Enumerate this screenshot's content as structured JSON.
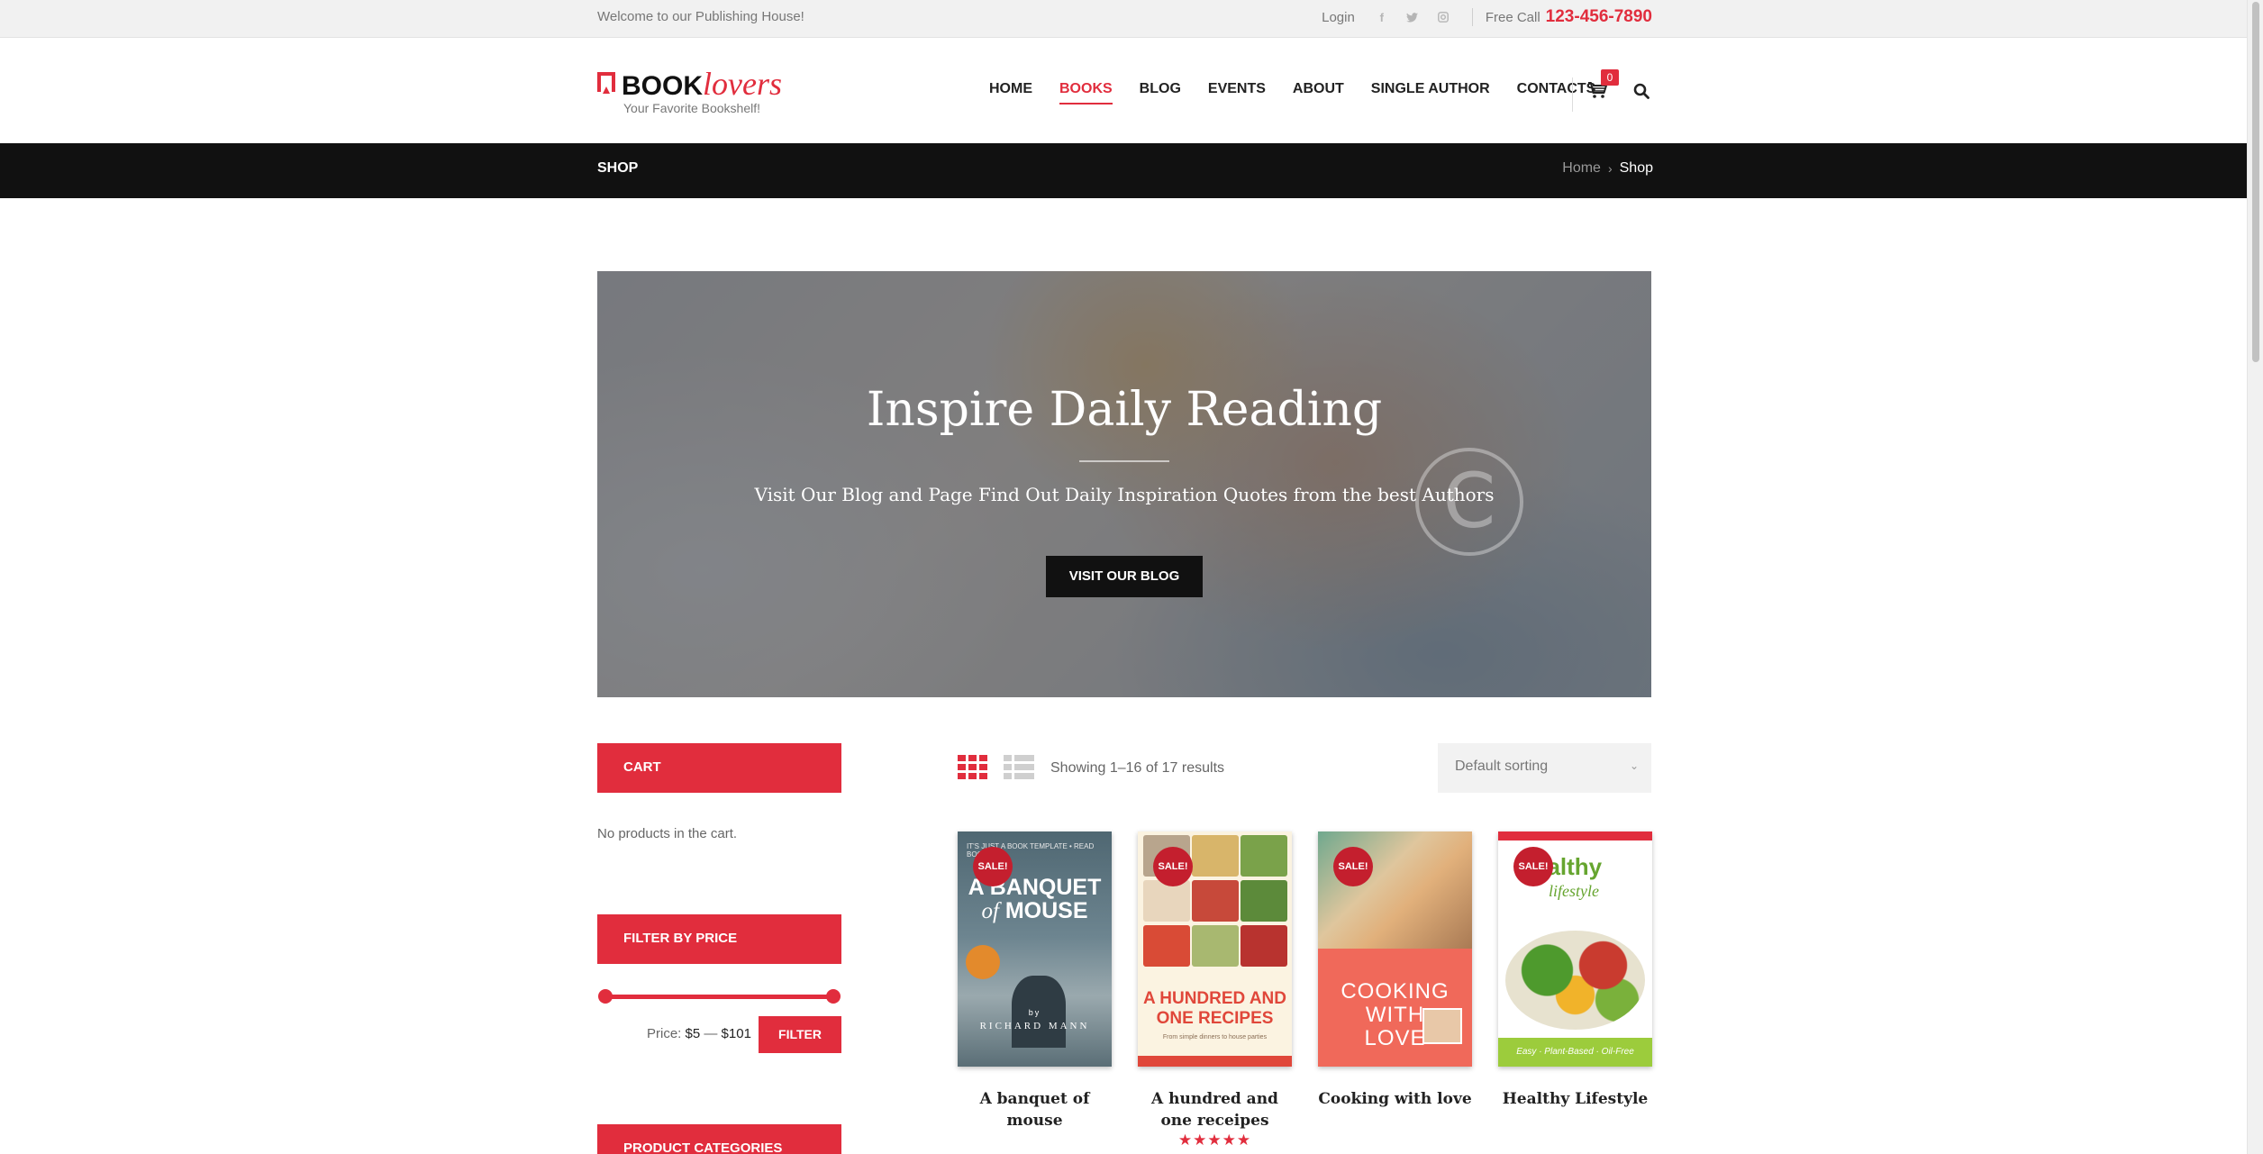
{
  "topbar": {
    "welcome": "Welcome to our Publishing House!",
    "login": "Login",
    "social_icons": [
      "facebook-icon",
      "twitter-icon",
      "instagram-icon"
    ],
    "free_call_label": "Free Call",
    "phone": "123-456-7890"
  },
  "logo": {
    "book": "BOOK",
    "lovers": "lovers",
    "tagline": "Your Favorite Bookshelf!"
  },
  "nav": {
    "items": [
      "HOME",
      "BOOKS",
      "BLOG",
      "EVENTS",
      "ABOUT",
      "SINGLE AUTHOR",
      "CONTACTS"
    ],
    "active": "BOOKS",
    "cart_count": "0"
  },
  "page": {
    "title": "SHOP",
    "breadcrumb": [
      "Home",
      "Shop"
    ]
  },
  "hero": {
    "heading": "Inspire Daily Reading",
    "subheading": "Visit Our Blog and Page Find Out Daily Inspiration Quotes from the best Authors",
    "button": "VISIT OUR BLOG"
  },
  "sidebar": {
    "cart_title": "CART",
    "cart_empty": "No products in the cart.",
    "filter_title": "FILTER BY PRICE",
    "price_label": "Price:",
    "price_min": "$5",
    "price_max": "$101",
    "filter_button": "FILTER",
    "categories_title": "PRODUCT CATEGORIES"
  },
  "shop": {
    "results": "Showing 1–16 of 17 results",
    "sort_selected": "Default sorting"
  },
  "products": [
    {
      "title": "A banquet of mouse",
      "sale": "SALE!",
      "cover_top": "IT'S JUST A BOOK TEMPLATE  •  READ BOOK",
      "cover_line1": "A BANQUET",
      "cover_of": "of",
      "cover_line2": "MOUSE",
      "cover_by": "by",
      "cover_author": "RICHARD MANN"
    },
    {
      "title": "A hundred and one receipes",
      "sale": "SALE!",
      "cover_line1": "A HUNDRED AND",
      "cover_line2": "ONE RECIPES",
      "cover_small": "From simple dinners to house parties",
      "rating": "★★★★★"
    },
    {
      "title": "Cooking with love",
      "sale": "SALE!",
      "cover_line1": "COOKING",
      "cover_line2": "WITH",
      "cover_line3": "LOVE"
    },
    {
      "title": "Healthy Lifestyle",
      "sale": "SALE!",
      "cover_line1": "ealthy",
      "cover_line2": "lifestyle",
      "cover_foot": "Easy · Plant-Based · Oil-Free"
    }
  ],
  "colors": {
    "accent": "#e12d3d",
    "dark": "#111111",
    "topbar_bg": "#f1f1f1"
  }
}
